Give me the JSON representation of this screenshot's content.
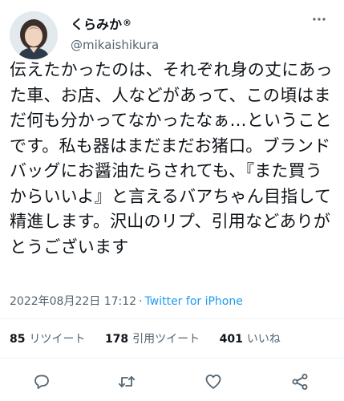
{
  "user": {
    "display_name": "くらみか",
    "registered_mark": "®",
    "handle": "@mikaishikura"
  },
  "tweet": {
    "text": "伝えたかったのは、それぞれ身の丈にあった車、お店、人などがあって、この頃はまだ何も分かってなかったなぁ…ということです。私も器はまだまだお猪口。ブランドバッグにお醤油たらされても、『また買うからいいよ』と言えるバアちゃん目指して精進します。沢山のリプ、引用などありがとうございます",
    "timestamp": "2022年08月22日 17:12",
    "separator": "·",
    "source": "Twitter for iPhone"
  },
  "stats": {
    "retweets_count": "85",
    "retweets_label": "リツイート",
    "quotes_count": "178",
    "quotes_label": "引用ツイート",
    "likes_count": "401",
    "likes_label": "いいね"
  },
  "icons": {
    "more": "more-dots-icon",
    "reply": "reply-bubble-icon",
    "retweet": "retweet-arrows-icon",
    "like": "heart-icon",
    "share": "share-nodes-icon"
  },
  "colors": {
    "text": "#0f1419",
    "secondary": "#536471",
    "link": "#1d9bf0",
    "divider": "#eff3f4",
    "icon": "#536471"
  }
}
